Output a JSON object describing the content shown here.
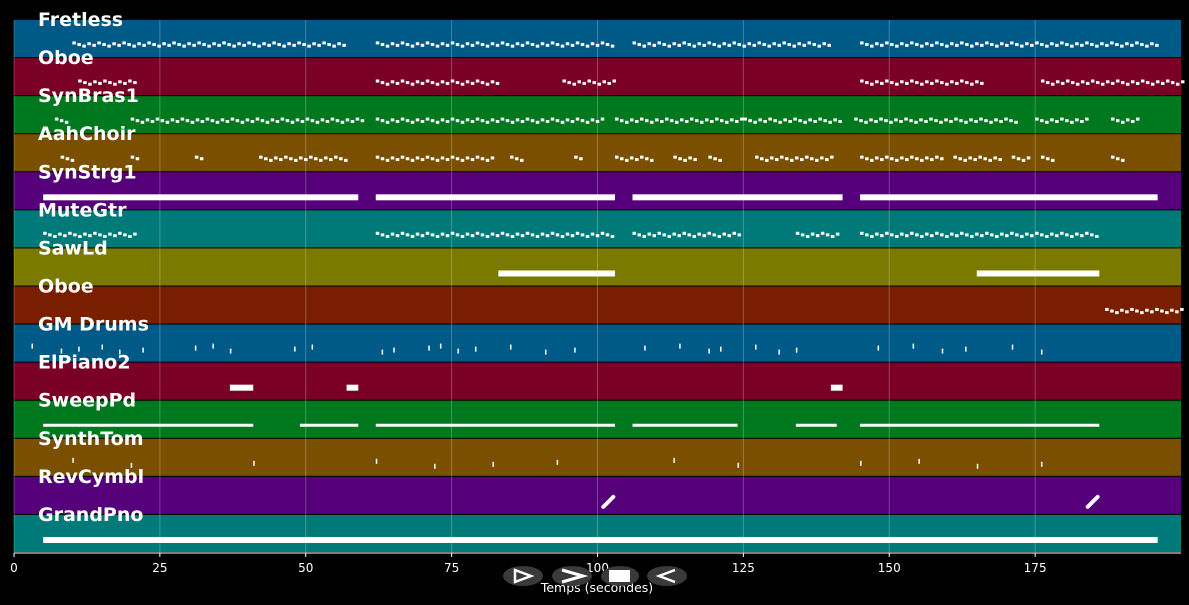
{
  "chart_data": {
    "type": "piano-roll",
    "xlabel": "Temps (secondes)",
    "xlim": [
      0,
      200
    ],
    "xticks": [
      0,
      25,
      50,
      75,
      100,
      125,
      150,
      175
    ],
    "grid": true,
    "tracks": [
      {
        "name": "Fretless",
        "color": "#005A87",
        "style": "dots",
        "segments": [
          [
            10,
            57
          ],
          [
            62,
            103
          ],
          [
            106,
            140
          ],
          [
            145,
            175
          ],
          [
            175,
            196
          ]
        ]
      },
      {
        "name": "Oboe",
        "color": "#7A0028",
        "style": "dots",
        "segments": [
          [
            11,
            21
          ],
          [
            62,
            83
          ],
          [
            94,
            103
          ],
          [
            145,
            166
          ],
          [
            176,
            200
          ]
        ]
      },
      {
        "name": "SynBras1",
        "color": "#00781E",
        "style": "dots",
        "segments": [
          [
            7,
            9
          ],
          [
            20,
            60
          ],
          [
            62,
            101
          ],
          [
            103,
            125
          ],
          [
            125,
            142
          ],
          [
            144,
            172
          ],
          [
            175,
            184
          ],
          [
            188,
            193
          ]
        ]
      },
      {
        "name": "AahChoir",
        "color": "#7A5000",
        "style": "dots",
        "segments": [
          [
            8,
            10
          ],
          [
            20,
            21
          ],
          [
            31,
            32
          ],
          [
            42,
            57
          ],
          [
            62,
            82
          ],
          [
            85,
            87
          ],
          [
            96,
            97
          ],
          [
            103,
            109
          ],
          [
            113,
            117
          ],
          [
            119,
            121
          ],
          [
            127,
            140
          ],
          [
            145,
            159
          ],
          [
            161,
            169
          ],
          [
            171,
            174
          ],
          [
            176,
            178
          ],
          [
            188,
            190
          ]
        ]
      },
      {
        "name": "SynStrg1",
        "color": "#55007A",
        "style": "bar",
        "segments": [
          [
            5,
            59
          ],
          [
            62,
            103
          ],
          [
            106,
            142
          ],
          [
            145,
            196
          ]
        ]
      },
      {
        "name": "MuteGtr",
        "color": "#007A78",
        "style": "dots",
        "segments": [
          [
            5,
            21
          ],
          [
            62,
            103
          ],
          [
            106,
            124
          ],
          [
            134,
            141
          ],
          [
            145,
            186
          ]
        ]
      },
      {
        "name": "SawLd",
        "color": "#7A7A00",
        "style": "bar",
        "segments": [
          [
            83,
            103
          ],
          [
            165,
            186
          ]
        ]
      },
      {
        "name": "Oboe",
        "color": "#7A1E00",
        "style": "dots",
        "segments": [
          [
            187,
            200
          ]
        ]
      },
      {
        "name": "GM Drums",
        "color": "#005A87",
        "style": "ticks",
        "points": [
          3,
          8,
          11,
          15,
          18,
          22,
          31,
          34,
          37,
          48,
          51,
          63,
          65,
          71,
          73,
          76,
          79,
          85,
          91,
          96,
          108,
          114,
          119,
          121,
          127,
          131,
          134,
          148,
          154,
          159,
          163,
          171,
          176
        ]
      },
      {
        "name": "ElPiano2",
        "color": "#7A0028",
        "style": "bar",
        "segments": [
          [
            37,
            41
          ],
          [
            57,
            59
          ],
          [
            140,
            142
          ]
        ]
      },
      {
        "name": "SweepPd",
        "color": "#00781E",
        "style": "line",
        "segments": [
          [
            5,
            41
          ],
          [
            49,
            59
          ],
          [
            62,
            103
          ],
          [
            106,
            124
          ],
          [
            134,
            141
          ],
          [
            145,
            186
          ]
        ]
      },
      {
        "name": "SynthTom",
        "color": "#7A5000",
        "style": "ticks",
        "points": [
          10,
          20,
          41,
          62,
          72,
          82,
          93,
          113,
          124,
          145,
          155,
          165,
          176
        ]
      },
      {
        "name": "RevCymbl",
        "color": "#55007A",
        "style": "slant",
        "points": [
          101,
          184
        ]
      },
      {
        "name": "GrandPno",
        "color": "#007A78",
        "style": "bar",
        "segments": [
          [
            5,
            196
          ]
        ]
      }
    ]
  },
  "controls": {
    "play_icon": "play-icon",
    "forward_icon": "forward-icon",
    "stop_icon": "stop-icon",
    "back_icon": "back-icon"
  }
}
